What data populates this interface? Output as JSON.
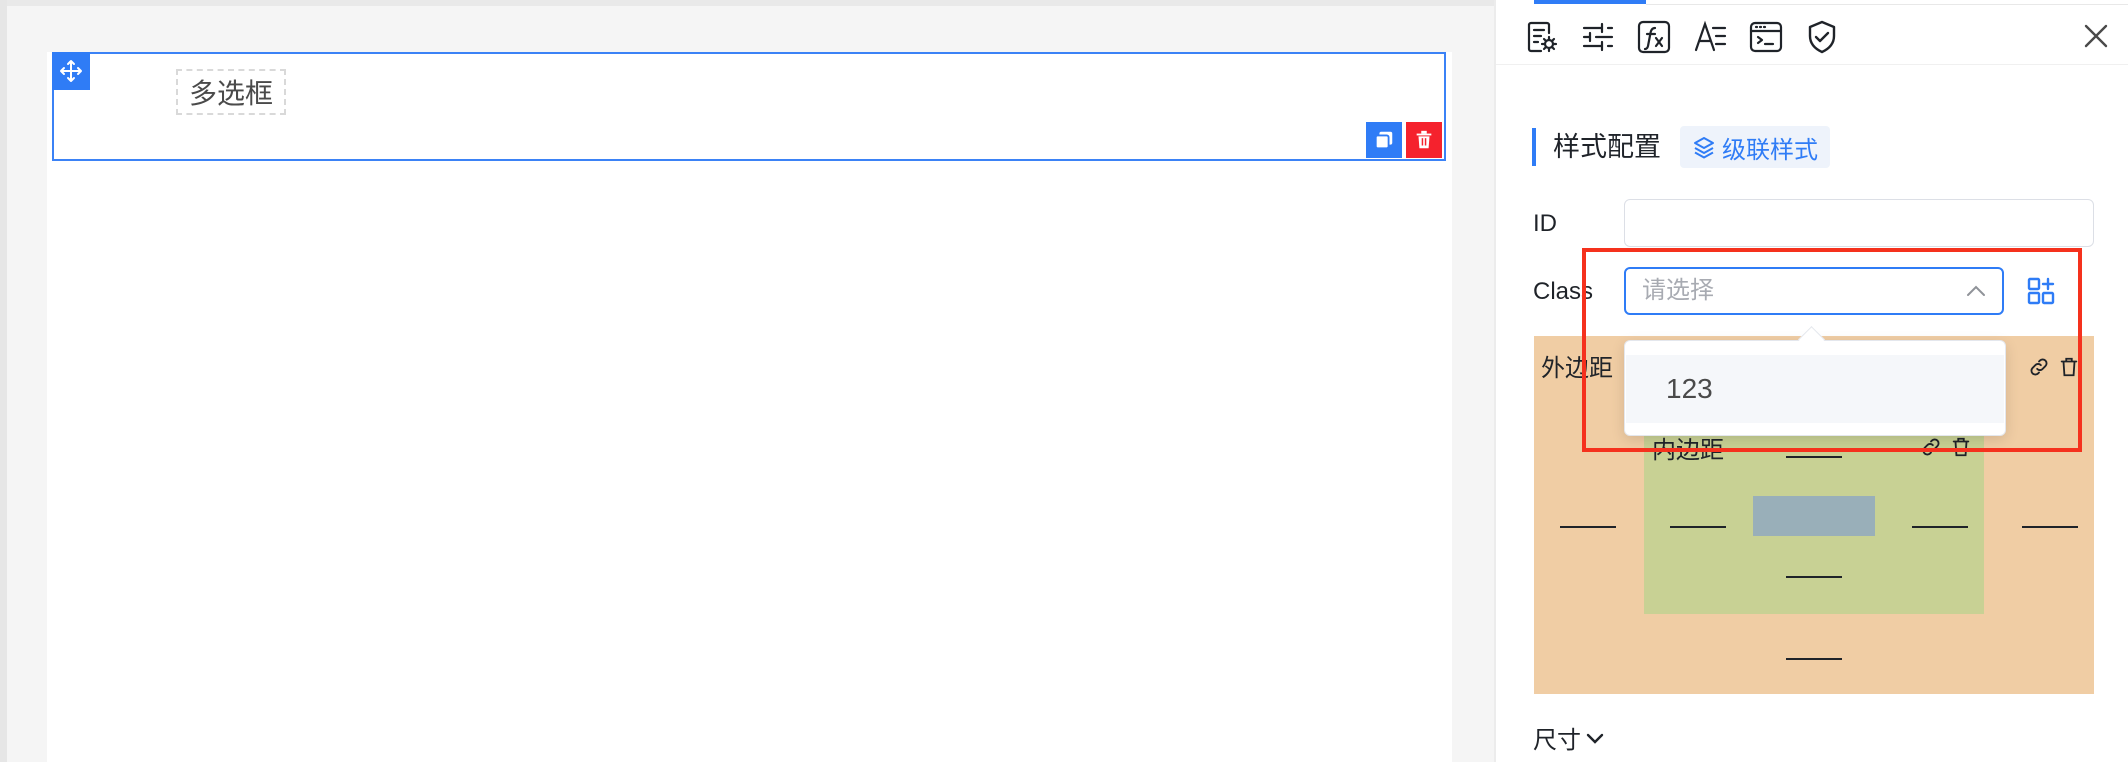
{
  "canvas": {
    "widget": {
      "label": "多选框"
    }
  },
  "panel": {
    "toolbar_icons": [
      "form-settings-icon",
      "sliders-icon",
      "function-icon",
      "text-style-icon",
      "script-icon",
      "shield-check-icon"
    ],
    "section_title": "样式配置",
    "cascade_button_label": "级联样式",
    "id_label": "ID",
    "id_value": "",
    "class_label": "Class",
    "class_placeholder": "请选择",
    "class_options": [
      "123"
    ],
    "margin_label": "外边距",
    "padding_label": "内边距",
    "size_label": "尺寸"
  },
  "colors": {
    "accent": "#2f7cf6",
    "danger": "#f5222d",
    "highlight": "#f5311d",
    "margin_fill": "#f0cda4",
    "padding_fill": "#c8d194",
    "content_fill": "#99afb9"
  }
}
